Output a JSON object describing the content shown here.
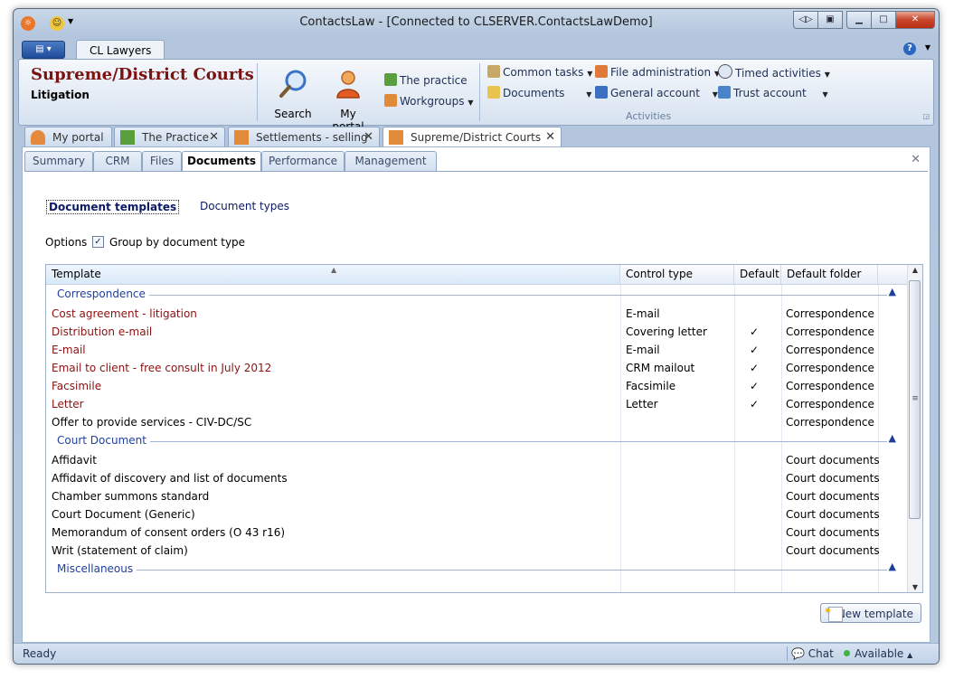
{
  "window": {
    "title": "ContactsLaw - [Connected to CLSERVER.ContactsLawDemo]"
  },
  "ribbon": {
    "tab": "CL Lawyers",
    "heading": "Supreme/District Courts",
    "subheading": "Litigation",
    "big_buttons": [
      "Search",
      "My portal"
    ],
    "small": {
      "the_practice": "The practice",
      "workgroups": "Workgroups",
      "common_tasks": "Common tasks",
      "documents": "Documents",
      "file_administration": "File administration",
      "general_account": "General account",
      "timed_activities": "Timed activities",
      "trust_account": "Trust account"
    },
    "group_label": "Activities"
  },
  "doc_tabs": [
    {
      "label": "My portal"
    },
    {
      "label": "The Practice"
    },
    {
      "label": "Settlements - selling"
    },
    {
      "label": "Supreme/District Courts"
    }
  ],
  "sub_tabs": [
    "Summary",
    "CRM",
    "Files",
    "Documents",
    "Performance",
    "Management"
  ],
  "links": {
    "templates": "Document templates",
    "types": "Document types"
  },
  "options": {
    "label": "Options",
    "group_by": "Group by document type",
    "group_by_checked": true
  },
  "grid": {
    "headers": [
      "Template",
      "Control type",
      "Default",
      "Default folder"
    ],
    "groups": [
      {
        "name": "Correspondence",
        "rows": [
          {
            "template": "Cost agreement - litigation",
            "control": "E-mail",
            "default": "",
            "folder": "Correspondence"
          },
          {
            "template": "Distribution e-mail",
            "control": "Covering letter",
            "default": "✓",
            "folder": "Correspondence"
          },
          {
            "template": "E-mail",
            "control": "E-mail",
            "default": "✓",
            "folder": "Correspondence"
          },
          {
            "template": "Email to client - free consult in July 2012",
            "control": "CRM mailout",
            "default": "✓",
            "folder": "Correspondence"
          },
          {
            "template": "Facsimile",
            "control": "Facsimile",
            "default": "✓",
            "folder": "Correspondence"
          },
          {
            "template": "Letter",
            "control": "Letter",
            "default": "✓",
            "folder": "Correspondence"
          },
          {
            "template": "Offer to provide services - CIV-DC/SC",
            "control": "",
            "default": "",
            "folder": "Correspondence"
          }
        ]
      },
      {
        "name": "Court Document",
        "rows": [
          {
            "template": "Affidavit",
            "control": "",
            "default": "",
            "folder": "Court documents"
          },
          {
            "template": "Affidavit of discovery and list of documents",
            "control": "",
            "default": "",
            "folder": "Court documents"
          },
          {
            "template": "Chamber summons standard",
            "control": "",
            "default": "",
            "folder": "Court documents"
          },
          {
            "template": "Court Document (Generic)",
            "control": "",
            "default": "",
            "folder": "Court documents"
          },
          {
            "template": "Memorandum of consent orders (O 43 r16)",
            "control": "",
            "default": "",
            "folder": "Court documents"
          },
          {
            "template": "Writ (statement of claim)",
            "control": "",
            "default": "",
            "folder": "Court documents"
          }
        ]
      },
      {
        "name": "Miscellaneous",
        "rows": []
      }
    ]
  },
  "new_template": "New template",
  "status": {
    "left": "Ready",
    "chat": "Chat",
    "availability": "Available"
  }
}
